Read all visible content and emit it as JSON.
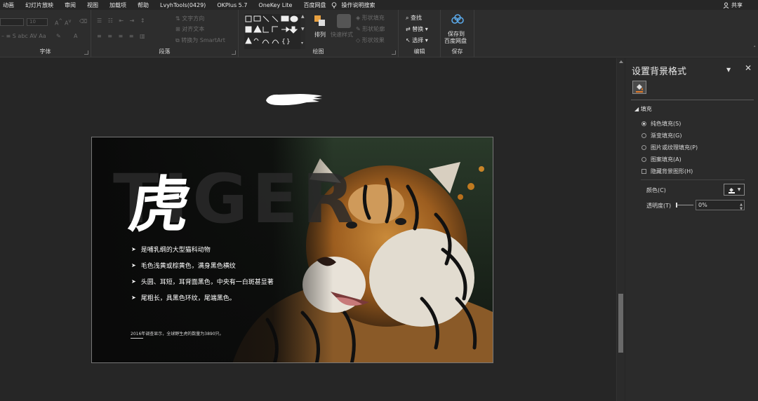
{
  "menubar": {
    "tabs": [
      "动画",
      "幻灯片放映",
      "审阅",
      "视图",
      "加载项",
      "帮助",
      "LvyhTools(0429)",
      "OKPlus 5.7",
      "OneKey Lite",
      "百度网盘",
      "操作说明搜索"
    ],
    "share": "共享"
  },
  "ribbon": {
    "font_group": {
      "label": "字体",
      "size": "10",
      "font_letter": "A"
    },
    "paragraph_group": {
      "label": "段落",
      "text_direction": "文字方向",
      "align_text": "对齐文本",
      "smartart": "转换为 SmartArt"
    },
    "drawing_group": {
      "label": "绘图",
      "arrange": "排列",
      "quick_styles": "快速样式",
      "shape_fill": "形状填充",
      "shape_outline": "形状轮廓",
      "shape_effects": "形状效果"
    },
    "editing_group": {
      "label": "编辑",
      "find": "查找",
      "replace": "替换",
      "select": "选择"
    },
    "save_group": {
      "label": "保存",
      "save_btn": "保存到\n百度网盘",
      "save_line1": "保存到",
      "save_line2": "百度网盘"
    }
  },
  "slide": {
    "bg_word": "TIGER",
    "title_char": "虎",
    "bullets": [
      "是哺乳纲的大型猫科动物",
      "毛色浅黄或棕黄色，满身黑色横纹",
      "头圆、耳短，耳背面黑色，中央有一白斑甚显著",
      "尾粗长，具黑色环纹，尾端黑色。"
    ],
    "bullet_marker": "➤",
    "footnote": "2016年调查显示，全球野生虎的数量为3890只。"
  },
  "pane": {
    "title": "设置背景格式",
    "section": "填充",
    "options": [
      {
        "label": "纯色填充(S)",
        "selected": true
      },
      {
        "label": "渐变填充(G)",
        "selected": false
      },
      {
        "label": "图片或纹理填充(P)",
        "selected": false
      },
      {
        "label": "图案填充(A)",
        "selected": false
      }
    ],
    "hide_bg": "隐藏背景图形(H)",
    "color_label": "颜色(C)",
    "transparency_label": "透明度(T)",
    "transparency_value": "0%"
  },
  "colors": {
    "app_bg": "#262626",
    "ribbon_bg": "#2d2d2d",
    "pane_bg": "#2b2b2b",
    "fill_icon_accent": "#e07a2a"
  }
}
